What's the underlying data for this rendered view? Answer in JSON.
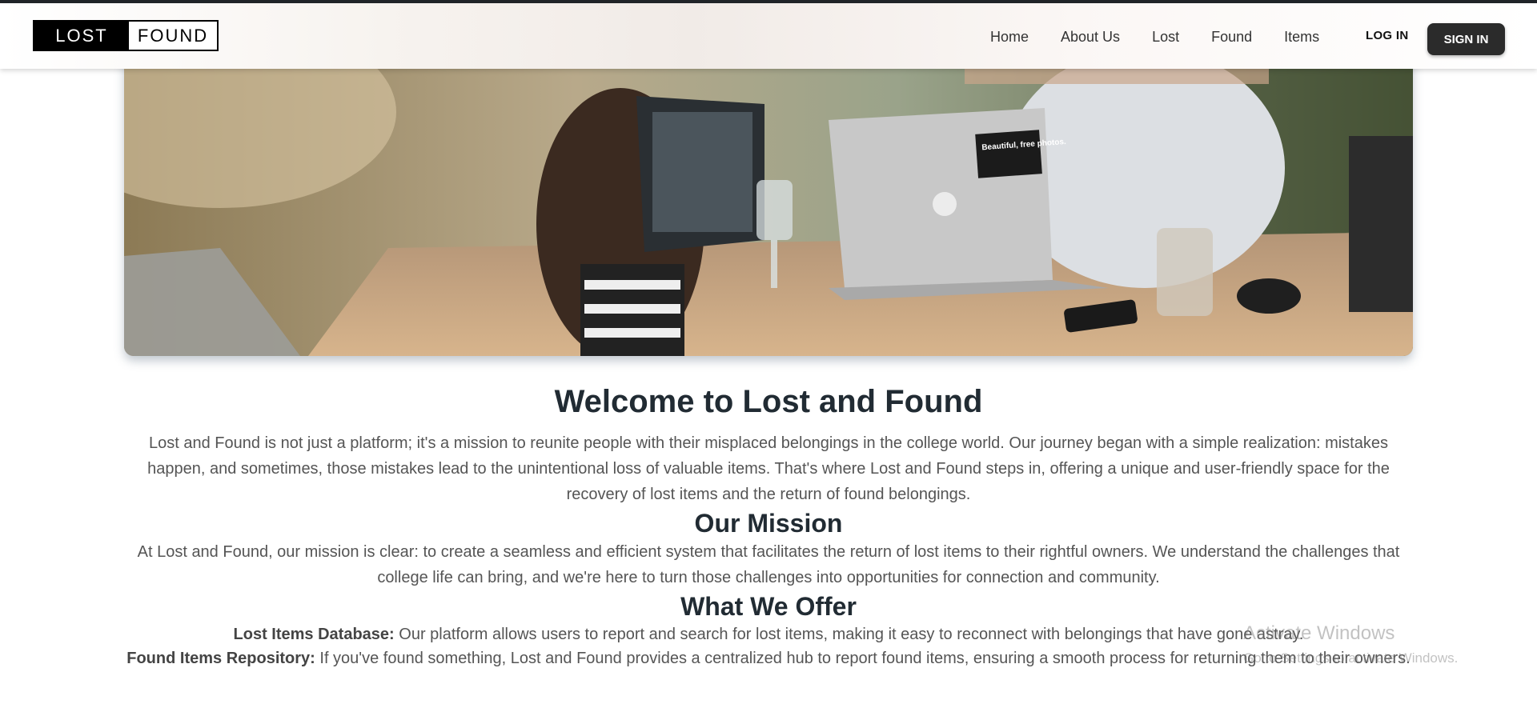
{
  "brand": {
    "left": "LOST",
    "right": "FOUND"
  },
  "nav": {
    "links": [
      "Home",
      "About Us",
      "Lost",
      "Found",
      "Items"
    ],
    "login_label": "LOG IN",
    "signin_label": "SIGN IN"
  },
  "hero": {
    "stock_sticker_text": "Beautiful, free photos."
  },
  "welcome": {
    "title": "Welcome to Lost and Found",
    "text": "Lost and Found is not just a platform; it's a mission to reunite people with their misplaced belongings in the college world. Our journey began with a simple realization: mistakes happen, and sometimes, those mistakes lead to the unintentional loss of valuable items. That's where Lost and Found steps in, offering a unique and user-friendly space for the recovery of lost items and the return of found belongings."
  },
  "mission": {
    "title": "Our Mission",
    "text": "At Lost and Found, our mission is clear: to create a seamless and efficient system that facilitates the return of lost items to their rightful owners. We understand the challenges that college life can bring, and we're here to turn those challenges into opportunities for connection and community."
  },
  "offer": {
    "title": "What We Offer",
    "items": [
      {
        "label": "Lost Items Database:",
        "text": " Our platform allows users to report and search for lost items, making it easy to reconnect with belongings that have gone astray."
      },
      {
        "label": "Found Items Repository:",
        "text": " If you've found something, Lost and Found provides a centralized hub to report found items, ensuring a smooth process for returning them to their owners."
      }
    ]
  },
  "watermark": {
    "title": "Activate Windows",
    "subtitle": "Go to Settings to activate Windows."
  },
  "colors": {
    "navbar_dark": "#212529",
    "signin_bg": "#2b2b2b",
    "heading": "#212b33",
    "body_text": "#555555"
  }
}
